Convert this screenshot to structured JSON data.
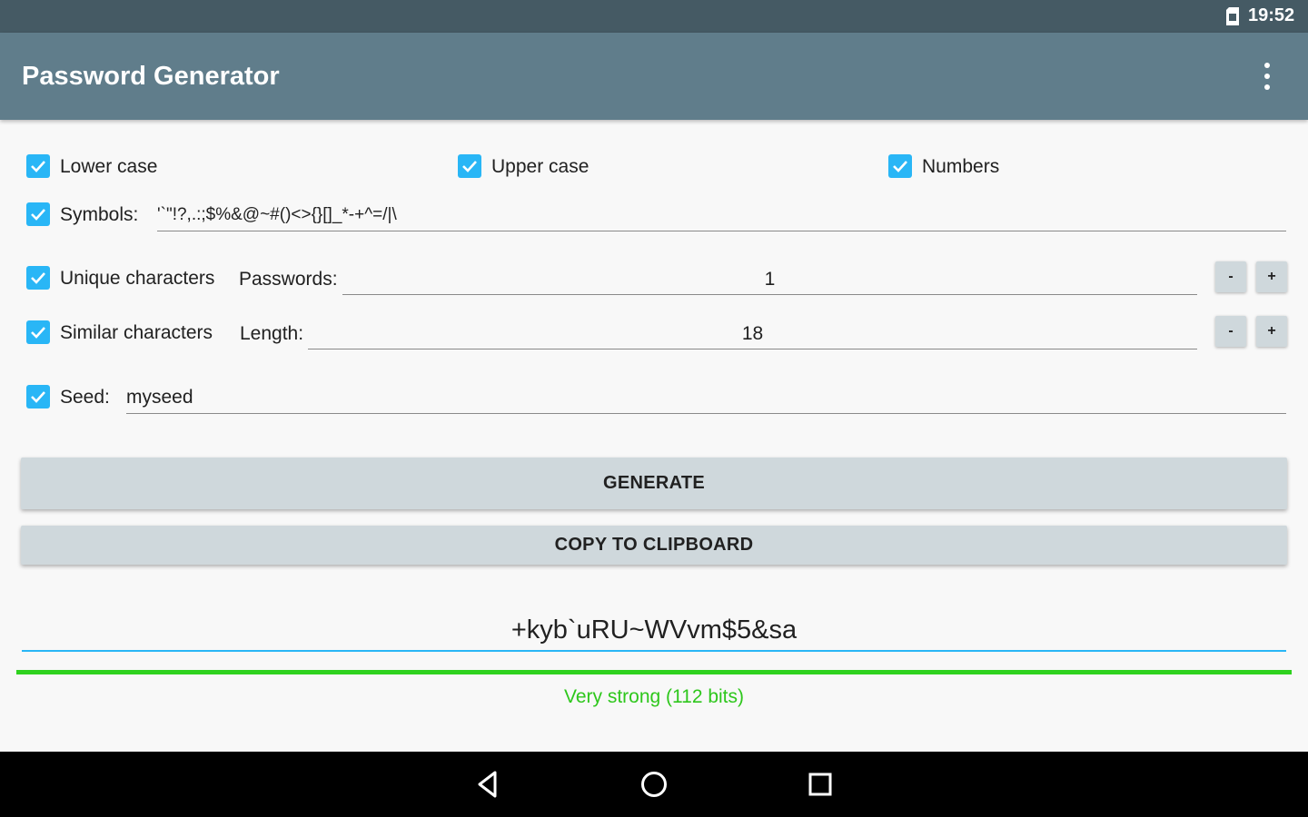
{
  "status_bar": {
    "time": "19:52",
    "sim_icon": "sim-card-icon"
  },
  "app_bar": {
    "title": "Password Generator",
    "menu_icon": "overflow-menu-icon"
  },
  "options": {
    "lower_case": {
      "label": "Lower case",
      "checked": true
    },
    "upper_case": {
      "label": "Upper case",
      "checked": true
    },
    "numbers": {
      "label": "Numbers",
      "checked": true
    },
    "symbols": {
      "label": "Symbols:",
      "checked": true,
      "value": "'`\"!?,.:;$%&@~#()<>{}[]_*-+^=/|\\"
    },
    "unique_characters": {
      "label": "Unique characters",
      "checked": true
    },
    "similar_characters": {
      "label": "Similar characters",
      "checked": true
    },
    "seed": {
      "label": "Seed:",
      "checked": true,
      "value": "myseed"
    }
  },
  "passwords": {
    "label": "Passwords:",
    "value": "1",
    "minus": "-",
    "plus": "+"
  },
  "length": {
    "label": "Length:",
    "value": "18",
    "minus": "-",
    "plus": "+"
  },
  "buttons": {
    "generate": "GENERATE",
    "copy": "COPY TO CLIPBOARD"
  },
  "result": {
    "password": "+kyb`uRU~WVvm$5&sa",
    "strength_text": "Very strong (112 bits)",
    "strength_fraction": 1.0,
    "strength_color": "#2fd21f"
  },
  "colors": {
    "accent": "#29b6f6",
    "app_bar": "#607d8b",
    "status_bar": "#455a64",
    "button": "#cfd8dc"
  },
  "nav": {
    "back_icon": "back-triangle-icon",
    "home_icon": "home-circle-icon",
    "recents_icon": "recents-square-icon"
  }
}
